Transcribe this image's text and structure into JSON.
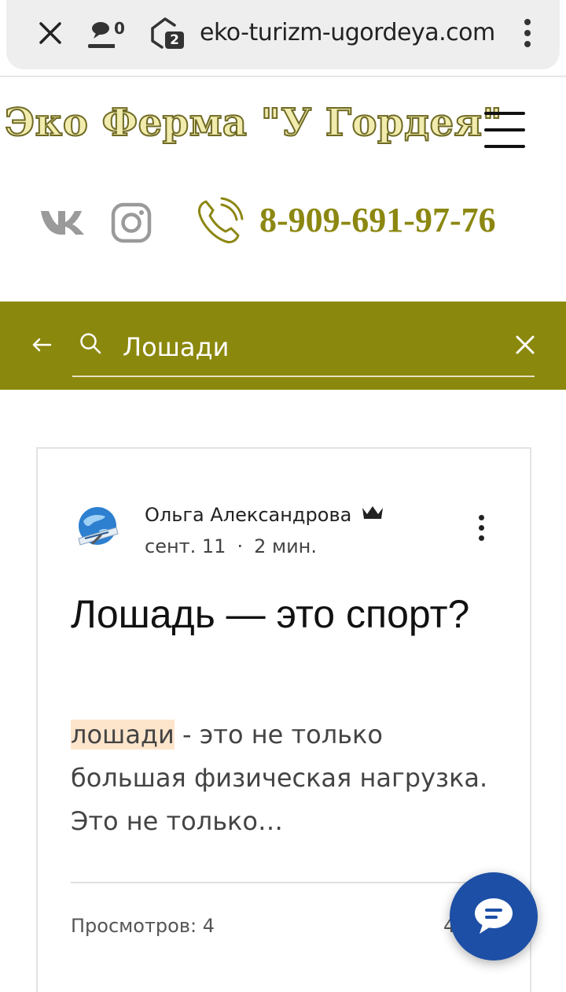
{
  "browser": {
    "chat_count": "0",
    "tabs_count": "2",
    "url": "eko-turizm-ugordeya.com"
  },
  "header": {
    "logo_text": "Эко Ферма \"У Гордея\"",
    "phone": "8-909-691-97-76"
  },
  "search": {
    "query": "Лошади",
    "accent_color": "#8b880e"
  },
  "post": {
    "author": "Ольга Александрова",
    "date": "сент. 11",
    "read_time": "2 мин.",
    "title": "Лошадь — это спорт?",
    "excerpt_highlight": "лошади",
    "excerpt_rest": " - это не только большая физическая нагрузка. Это не только…",
    "views": "Просмотров: 4",
    "likes": "4"
  },
  "icons": [
    "close-icon",
    "chat-icon",
    "shield-tabs-icon",
    "more-vert-icon",
    "hamburger-icon",
    "vk-icon",
    "instagram-icon",
    "phone-icon",
    "back-arrow-icon",
    "search-icon",
    "clear-icon",
    "crown-icon",
    "chat-bubble-icon"
  ]
}
